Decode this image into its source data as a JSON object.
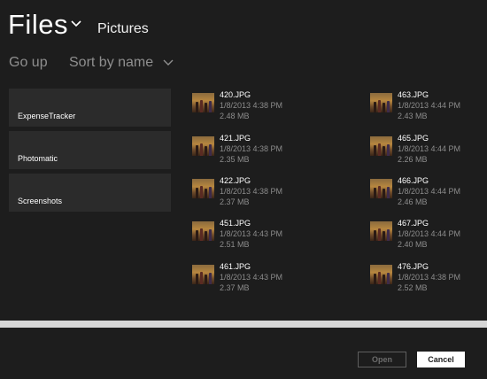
{
  "header": {
    "title": "Files",
    "location": "Pictures",
    "go_up": "Go up",
    "sort_by": "Sort by name"
  },
  "folders": [
    {
      "label": "ExpenseTracker"
    },
    {
      "label": "Photomatic"
    },
    {
      "label": "Screenshots"
    }
  ],
  "files": [
    {
      "name": "420.JPG",
      "date": "1/8/2013 4:38 PM",
      "size": "2.48 MB"
    },
    {
      "name": "421.JPG",
      "date": "1/8/2013 4:38 PM",
      "size": "2.35 MB"
    },
    {
      "name": "422.JPG",
      "date": "1/8/2013 4:38 PM",
      "size": "2.37 MB"
    },
    {
      "name": "451.JPG",
      "date": "1/8/2013 4:43 PM",
      "size": "2.51 MB"
    },
    {
      "name": "461.JPG",
      "date": "1/8/2013 4:43 PM",
      "size": "2.37 MB"
    },
    {
      "name": "463.JPG",
      "date": "1/8/2013 4:44 PM",
      "size": "2.43 MB"
    },
    {
      "name": "465.JPG",
      "date": "1/8/2013 4:44 PM",
      "size": "2.26 MB"
    },
    {
      "name": "466.JPG",
      "date": "1/8/2013 4:44 PM",
      "size": "2.46 MB"
    },
    {
      "name": "467.JPG",
      "date": "1/8/2013 4:44 PM",
      "size": "2.40 MB"
    },
    {
      "name": "476.JPG",
      "date": "1/8/2013 4:38 PM",
      "size": "2.52 MB"
    }
  ],
  "footer": {
    "open_label": "Open",
    "cancel_label": "Cancel"
  },
  "icons": {
    "title_dropdown": "chevron-down-icon",
    "sort_dropdown": "chevron-down-icon",
    "file_thumbnail": "photo-thumbnail-icon"
  },
  "colors": {
    "background": "#1d1d1d",
    "tile": "#2b2b2b",
    "muted_text": "#8f8f8f",
    "scrollbar": "#d6d6d6"
  }
}
